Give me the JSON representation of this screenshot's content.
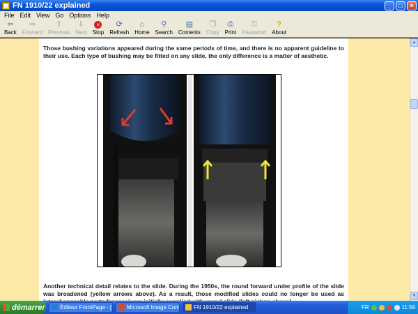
{
  "window": {
    "title": "FN 1910/22 explained",
    "min": "_",
    "max": "□",
    "close": "×"
  },
  "menu": [
    "File",
    "Edit",
    "View",
    "Go",
    "Options",
    "Help"
  ],
  "toolbar": [
    {
      "label": "Back",
      "icon": "back-arrow-icon",
      "glyph": "⇦",
      "enabled": true,
      "cls": "ico-green"
    },
    {
      "label": "Forward",
      "icon": "forward-arrow-icon",
      "glyph": "⇨",
      "enabled": false,
      "cls": ""
    },
    {
      "label": "Previous",
      "icon": "up-arrow-icon",
      "glyph": "⇧",
      "enabled": false,
      "cls": ""
    },
    {
      "label": "Next",
      "icon": "down-arrow-icon",
      "glyph": "⇩",
      "enabled": false,
      "cls": ""
    },
    {
      "label": "Stop",
      "icon": "stop-icon",
      "glyph": "×",
      "enabled": true,
      "cls": "ico-red"
    },
    {
      "label": "Refresh",
      "icon": "refresh-icon",
      "glyph": "⟳",
      "enabled": true,
      "cls": "ico-blue"
    },
    {
      "label": "Home",
      "icon": "home-icon",
      "glyph": "⌂",
      "enabled": true,
      "cls": "ico-home"
    },
    {
      "label": "Search",
      "icon": "search-icon",
      "glyph": "⚲",
      "enabled": true,
      "cls": "ico-blue"
    },
    {
      "label": "Contents",
      "icon": "contents-icon",
      "glyph": "▤",
      "enabled": true,
      "cls": "ico-blue"
    },
    {
      "label": "Copy",
      "icon": "copy-icon",
      "glyph": "❐",
      "enabled": false,
      "cls": ""
    },
    {
      "label": "Print",
      "icon": "print-icon",
      "glyph": "⎙",
      "enabled": true,
      "cls": "ico-blue"
    },
    {
      "label": "Password",
      "icon": "password-icon",
      "glyph": "⚿",
      "enabled": false,
      "cls": ""
    },
    {
      "label": "About",
      "icon": "about-icon",
      "glyph": "?",
      "enabled": true,
      "cls": "ico-yellow"
    }
  ],
  "content": {
    "paragraph1": "Those bushing variations appeared during the same periods of time, and there is no apparent guideline to their use. Each type of bushing may be fitted on any slide, the only difference is a matter of aesthetic.",
    "paragraph2": "Another technical detail relates to the slide. During the 1950s, the round forward under profile of the slide was broadened (yellow arrows above). As a result, those modified slides could no longer be used as interchangeable parts for receivers initially supplied with round slide (left picture above)."
  },
  "taskbar": {
    "start": "démarrer",
    "items": [
      {
        "label": "Éditeur FrontPage - [...",
        "active": false,
        "color": "#2e7bd6"
      },
      {
        "label": "Microsoft Image Com...",
        "active": false,
        "color": "#d94a2a"
      },
      {
        "label": "FN 1910/22 explained",
        "active": true,
        "color": "#f2c230"
      }
    ],
    "lang": "FR",
    "time": "11:59"
  }
}
